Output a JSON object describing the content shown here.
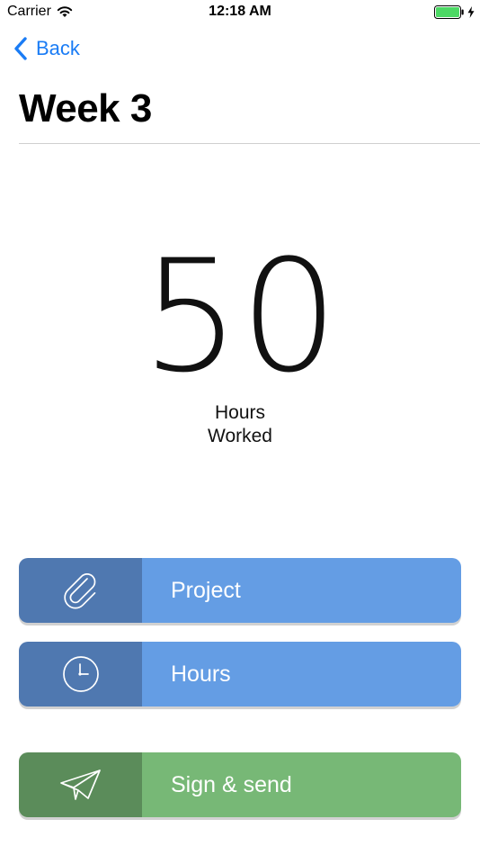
{
  "status_bar": {
    "carrier": "Carrier",
    "time": "12:18 AM",
    "icons": [
      "wifi-icon",
      "battery-icon",
      "bolt-icon"
    ],
    "battery_color": "#4cd964"
  },
  "nav": {
    "back_label": "Back",
    "accent_color": "#1a7cf5"
  },
  "page": {
    "title": "Week 3"
  },
  "summary": {
    "value": "50",
    "label_line1": "Hours",
    "label_line2": "Worked"
  },
  "actions": [
    {
      "label": "Project",
      "icon": "paperclip-icon",
      "color": "#649de4",
      "icon_bg": "#4f78b0"
    },
    {
      "label": "Hours",
      "icon": "clock-icon",
      "color": "#649de4",
      "icon_bg": "#4f78b0"
    },
    {
      "label": "Sign & send",
      "icon": "paper-plane-icon",
      "color": "#77b876",
      "icon_bg": "#5b8c5a"
    }
  ]
}
